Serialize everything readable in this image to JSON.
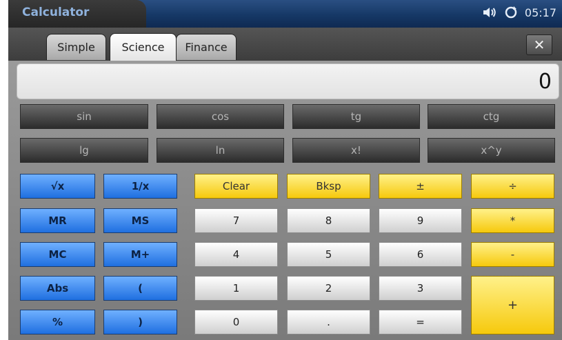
{
  "app": {
    "title": "Calculator"
  },
  "status": {
    "time": "05:17",
    "icons": [
      "speaker-icon",
      "sync-icon"
    ]
  },
  "tabs": [
    {
      "label": "Simple",
      "active": false
    },
    {
      "label": "Science",
      "active": true
    },
    {
      "label": "Finance",
      "active": false
    }
  ],
  "close": {
    "label": "✕"
  },
  "display": {
    "value": "0"
  },
  "functions": {
    "row1": [
      "sin",
      "cos",
      "tg",
      "ctg"
    ],
    "row2": [
      "lg",
      "ln",
      "x!",
      "x^y"
    ]
  },
  "memory": {
    "sqrt": "√x",
    "recip": "1/x",
    "mr": "MR",
    "ms": "MS",
    "mc": "MC",
    "mplus": "M+",
    "abs": "Abs",
    "lparen": "(",
    "percent": "%",
    "rparen": ")"
  },
  "controls": {
    "clear": "Clear",
    "bksp": "Bksp",
    "sign": "±"
  },
  "operators": {
    "divide": "÷",
    "multiply": "*",
    "minus": "-",
    "plus": "+",
    "equals": "="
  },
  "digits": {
    "d7": "7",
    "d8": "8",
    "d9": "9",
    "d4": "4",
    "d5": "5",
    "d6": "6",
    "d1": "1",
    "d2": "2",
    "d3": "3",
    "d0": "0",
    "dot": "."
  },
  "colors": {
    "accent_blue": "#1f6fe0",
    "accent_yellow": "#f6c90c",
    "titlebar": "#163866"
  }
}
